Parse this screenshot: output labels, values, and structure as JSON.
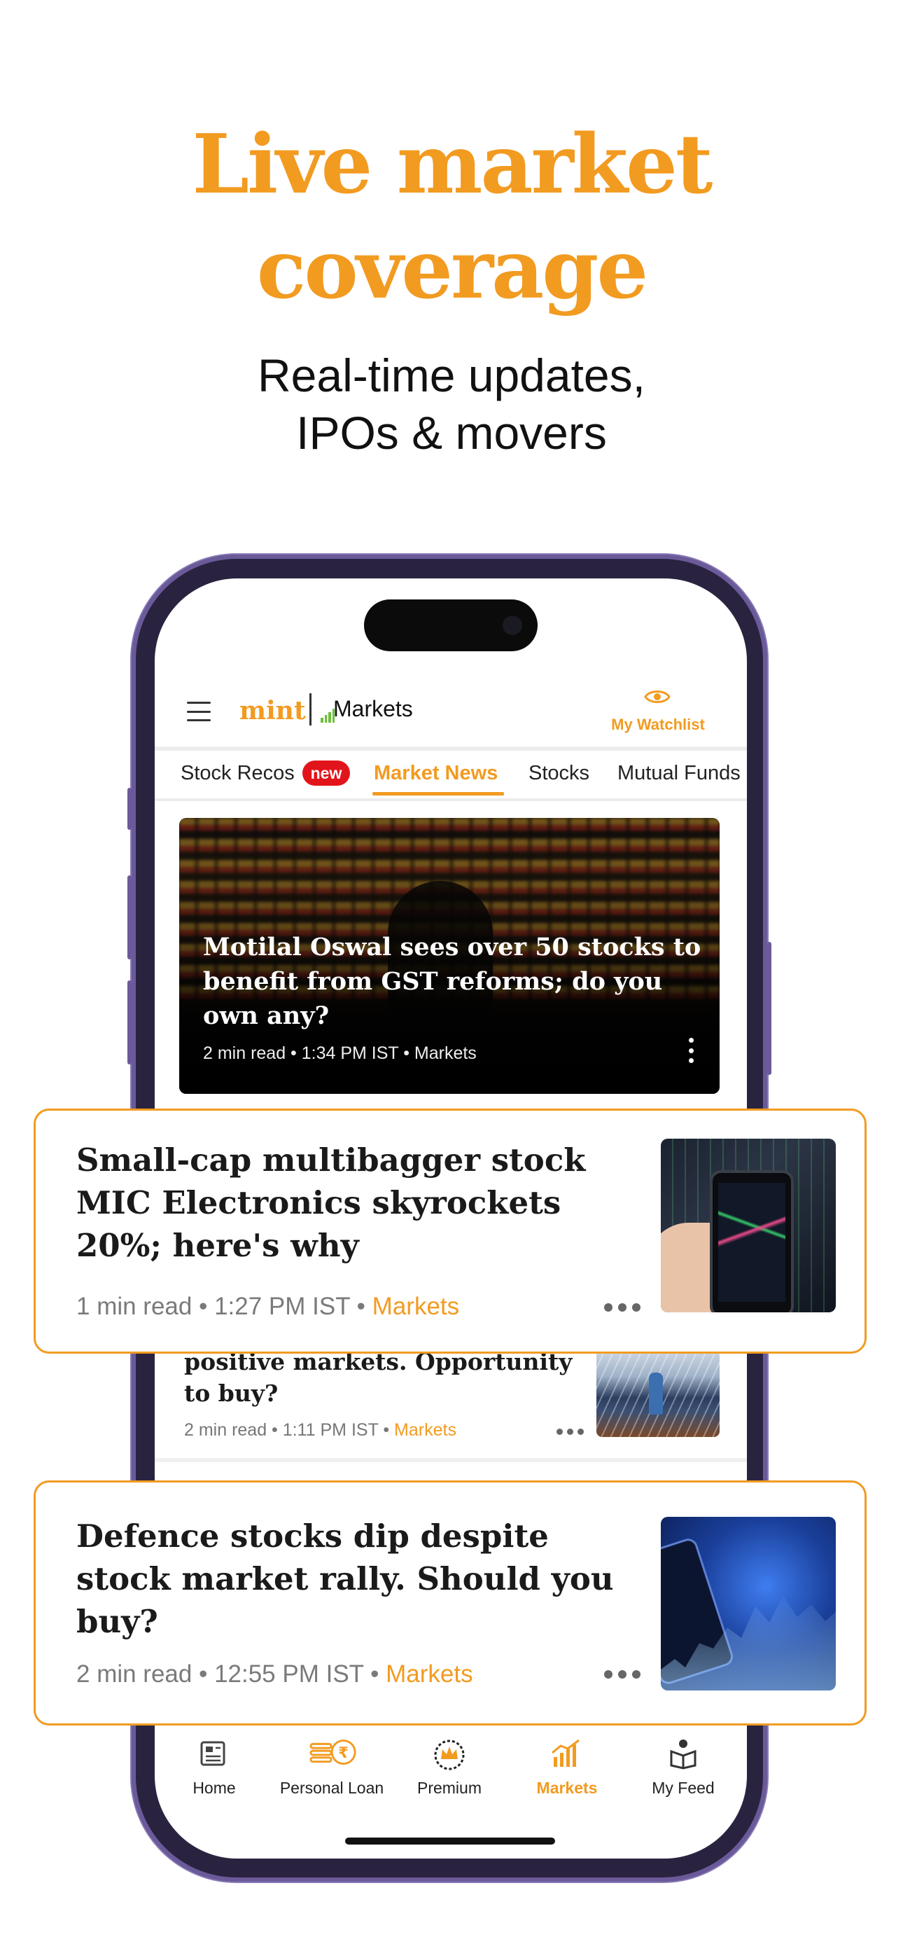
{
  "hero": {
    "title_line1": "Live market",
    "title_line2": "coverage",
    "subtitle_line1": "Real-time updates,",
    "subtitle_line2": "IPOs & movers"
  },
  "app": {
    "logo_mint": "mint",
    "logo_section": "Markets",
    "watchlist_label": "My Watchlist",
    "brand_color": "#f29b21"
  },
  "tabs": [
    {
      "label": "Stock Recos",
      "badge": "new",
      "active": false
    },
    {
      "label": "Market News",
      "active": true
    },
    {
      "label": "Stocks",
      "active": false
    },
    {
      "label": "Mutual Funds",
      "active": false
    }
  ],
  "featured": {
    "headline": "Motilal Oswal sees over 50 stocks to benefit from GST reforms; do you own any?",
    "meta": "2 min read • 1:34 PM IST •",
    "category": "Markets"
  },
  "list_partial": {
    "headline": "positive markets. Opportunity to buy?",
    "meta": "2 min read • 1:11 PM IST •",
    "category": "Markets"
  },
  "cards": [
    {
      "headline": "Small-cap multibagger stock MIC Electronics skyrockets 20%; here's why",
      "meta": "1 min read • 1:27 PM IST •",
      "category": "Markets"
    },
    {
      "headline": "Defence stocks dip despite stock market rally. Should you buy?",
      "meta": "2 min read • 12:55 PM IST •",
      "category": "Markets"
    }
  ],
  "nav": [
    {
      "label": "Home",
      "icon": "newspaper-icon",
      "active": false
    },
    {
      "label": "Personal Loan",
      "icon": "rupee-coins-icon",
      "active": false
    },
    {
      "label": "Premium",
      "icon": "crown-icon",
      "active": false
    },
    {
      "label": "Markets",
      "icon": "bar-chart-icon",
      "active": true
    },
    {
      "label": "My Feed",
      "icon": "reader-icon",
      "active": false
    }
  ]
}
